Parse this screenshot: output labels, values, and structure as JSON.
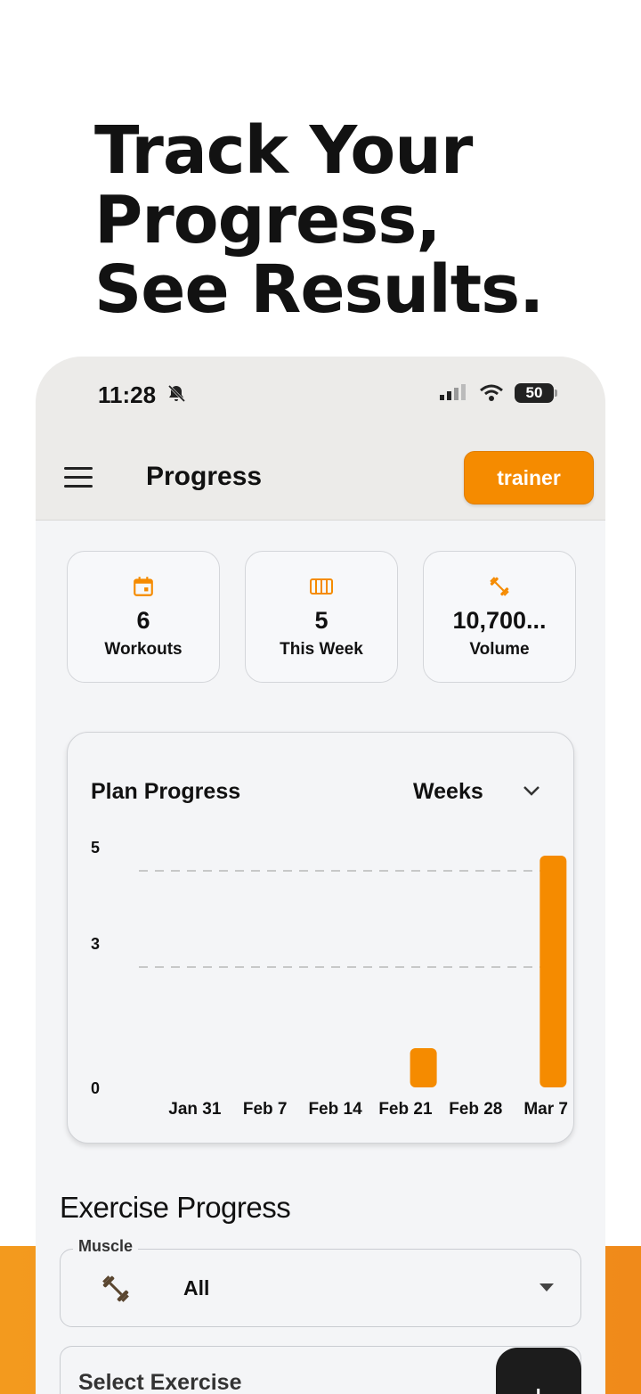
{
  "promo": {
    "headline_line1": "Track Your",
    "headline_line2": "Progress,",
    "headline_line3": "See Results."
  },
  "status_bar": {
    "time": "11:28",
    "battery": "50"
  },
  "app_bar": {
    "title": "Progress",
    "trainer_label": "trainer"
  },
  "stats": [
    {
      "icon": "calendar-icon",
      "value": "6",
      "label": "Workouts"
    },
    {
      "icon": "week-columns-icon",
      "value": "5",
      "label": "This Week"
    },
    {
      "icon": "dumbbell-icon",
      "value": "10,700...",
      "label": "Volume"
    }
  ],
  "chart": {
    "title": "Plan Progress",
    "period": "Weeks"
  },
  "chart_data": {
    "type": "bar",
    "title": "Plan Progress",
    "categories": [
      "Jan 31",
      "Feb 7",
      "Feb 14",
      "Feb 21",
      "Feb 28",
      "Mar 7"
    ],
    "values": [
      0,
      0,
      0,
      1,
      0,
      5
    ],
    "y_tick_labels": [
      "0",
      "3",
      "5"
    ],
    "ylim": [
      0,
      5
    ],
    "grid": true,
    "bar_color": "#f58b00"
  },
  "exercise_progress": {
    "title": "Exercise Progress",
    "muscle_label": "Muscle",
    "muscle_value": "All",
    "exercise_placeholder": "Select Exercise",
    "fab_label": "+"
  },
  "colors": {
    "accent": "#f58b00",
    "band": "#f39a1e"
  }
}
